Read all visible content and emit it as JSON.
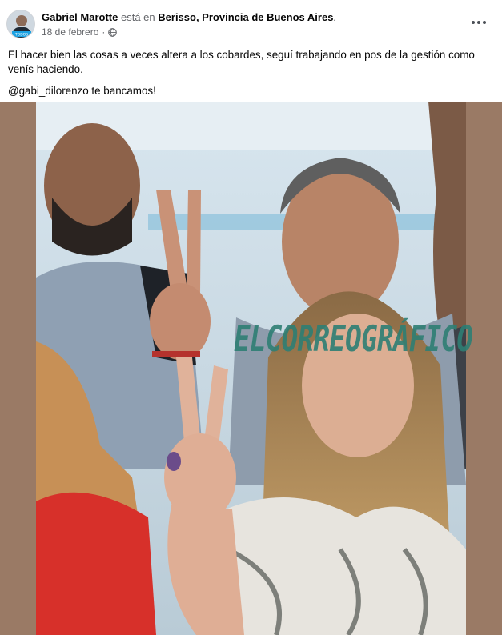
{
  "post": {
    "author": "Gabriel Marotte",
    "checkin_verb": "está en",
    "place": "Berisso, Provincia de Buenos Aires",
    "place_end": ".",
    "date": "18 de febrero",
    "date_sep": "·",
    "privacy_icon": "globe-icon",
    "more_icon": "more-options-icon",
    "body_line1": "El hacer bien las cosas a veces altera a los cobardes, seguí trabajando en pos de la gestión como venís haciendo.",
    "body_line2": "@gabi_dilorenzo te bancamos!",
    "avatar_badge": "TODOS"
  },
  "photo": {
    "watermark": "ELCORREOGRÁFICO"
  },
  "colors": {
    "photo_side_background": "#9a7a65",
    "watermark": "#2e7f74",
    "muted_text": "#65676b"
  }
}
